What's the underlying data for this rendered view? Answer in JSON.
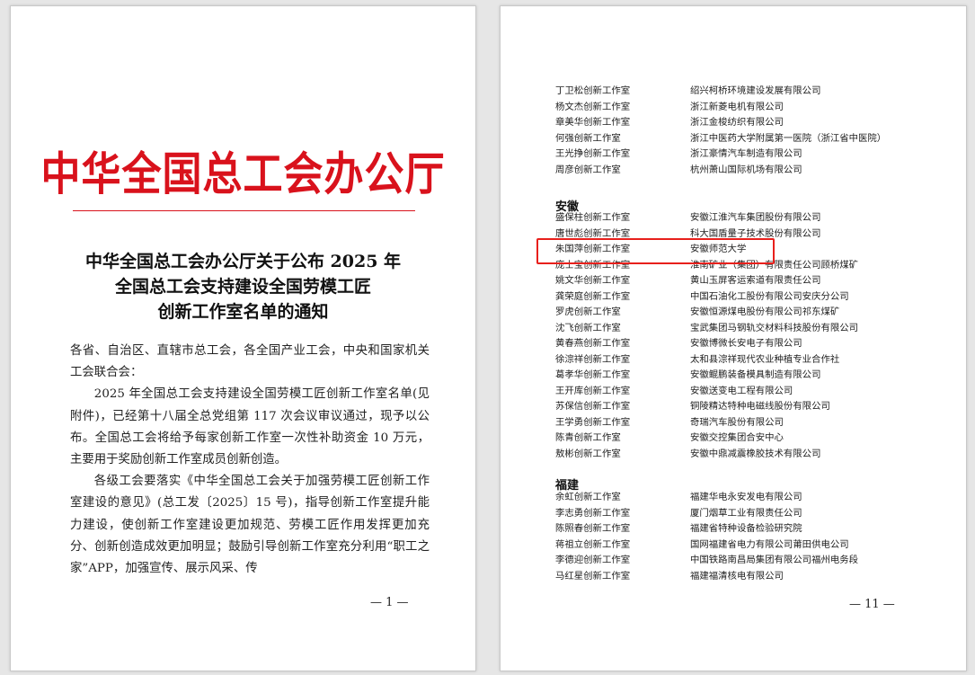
{
  "left_page": {
    "masthead": "中华全国总工会办公厅",
    "title_lines": [
      "中华全国总工会办公厅关于公布 2025 年",
      "全国总工会支持建设全国劳模工匠",
      "创新工作室名单的通知"
    ],
    "paragraphs": [
      {
        "text": "各省、自治区、直辖市总工会，各全国产业工会，中央和国家机关工会联合会：",
        "indent": false
      },
      {
        "text": "2025 年全国总工会支持建设全国劳模工匠创新工作室名单(见附件)，已经第十八届全总党组第 117 次会议审议通过，现予以公布。全国总工会将给予每家创新工作室一次性补助资金 10 万元，主要用于奖励创新工作室成员创新创造。",
        "indent": true
      },
      {
        "text": "各级工会要落实《中华全国总工会关于加强劳模工匠创新工作室建设的意见》(总工发〔2025〕15 号)，指导创新工作室提升能力建设，使创新工作室建设更加规范、劳模工匠作用发挥更加充分、创新创造成效更加明显；鼓励引导创新工作室充分利用“职工之家”APP，加强宣传、展示风采、传",
        "indent": true
      }
    ],
    "page_number": "— 1 —"
  },
  "right_page": {
    "group_zhejiang_tail": [
      [
        "丁卫松创新工作室",
        "绍兴柯桥环境建设发展有限公司"
      ],
      [
        "杨文杰创新工作室",
        "浙江新菱电机有限公司"
      ],
      [
        "章美华创新工作室",
        "浙江金梭纺织有限公司"
      ],
      [
        "何强创新工作室",
        "浙江中医药大学附属第一医院（浙江省中医院）"
      ],
      [
        "王光挣创新工作室",
        "浙江豪情汽车制造有限公司"
      ],
      [
        "周彦创新工作室",
        "杭州萧山国际机场有限公司"
      ]
    ],
    "province_anhui": "安徽",
    "group_anhui": [
      [
        "盛保柱创新工作室",
        "安徽江淮汽车集团股份有限公司"
      ],
      [
        "唐世彪创新工作室",
        "科大国盾量子技术股份有限公司"
      ],
      [
        "朱国萍创新工作室",
        "安徽师范大学"
      ],
      [
        "庞士宝创新工作室",
        "淮南矿业（集团）有限责任公司顾桥煤矿"
      ],
      [
        "姚文华创新工作室",
        "黄山玉屏客运索道有限责任公司"
      ],
      [
        "龚荣庭创新工作室",
        "中国石油化工股份有限公司安庆分公司"
      ],
      [
        "罗虎创新工作室",
        "安徽恒源煤电股份有限公司祁东煤矿"
      ],
      [
        "沈飞创新工作室",
        "宝武集团马钢轨交材料科技股份有限公司"
      ],
      [
        "黄春燕创新工作室",
        "安徽博微长安电子有限公司"
      ],
      [
        "徐淙祥创新工作室",
        "太和县淙祥现代农业种植专业合作社"
      ],
      [
        "葛孝华创新工作室",
        "安徽鲲鹏装备模具制造有限公司"
      ],
      [
        "王开库创新工作室",
        "安徽送变电工程有限公司"
      ],
      [
        "苏保信创新工作室",
        "铜陵精达特种电磁线股份有限公司"
      ],
      [
        "王学勇创新工作室",
        "奇瑞汽车股份有限公司"
      ],
      [
        "陈青创新工作室",
        "安徽交控集团合安中心"
      ],
      [
        "敖彬创新工作室",
        "安徽中鼎减震橡胶技术有限公司"
      ]
    ],
    "province_fujian": "福建",
    "group_fujian": [
      [
        "余虹创新工作室",
        "福建华电永安发电有限公司"
      ],
      [
        "李志勇创新工作室",
        "厦门烟草工业有限责任公司"
      ],
      [
        "陈照春创新工作室",
        "福建省特种设备检验研究院"
      ],
      [
        "蒋祖立创新工作室",
        "国网福建省电力有限公司莆田供电公司"
      ],
      [
        "李德迎创新工作室",
        "中国铁路南昌局集团有限公司福州电务段"
      ],
      [
        "马红星创新工作室",
        "福建福清核电有限公司"
      ]
    ],
    "page_number": "— 11 —"
  },
  "colors": {
    "masthead_red": "#d9121c",
    "highlight_red": "#e8201c"
  }
}
